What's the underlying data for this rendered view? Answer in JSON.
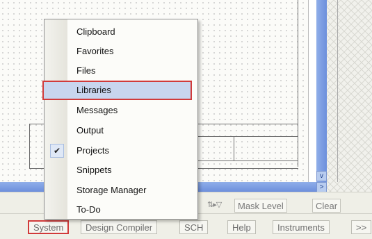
{
  "menu": {
    "items": [
      {
        "label": "Clipboard"
      },
      {
        "label": "Favorites"
      },
      {
        "label": "Files"
      },
      {
        "label": "Libraries"
      },
      {
        "label": "Messages"
      },
      {
        "label": "Output"
      },
      {
        "label": "Projects"
      },
      {
        "label": "Snippets"
      },
      {
        "label": "Storage Manager"
      },
      {
        "label": "To-Do"
      }
    ],
    "selected": "Libraries",
    "checked": "Projects"
  },
  "mask_toolbar": {
    "mask_level_label": "Mask Level",
    "clear_label": "Clear"
  },
  "panel_tabs": [
    "System",
    "Design Compiler",
    "SCH",
    "Help",
    "Instruments",
    ">>"
  ],
  "scroll": {
    "right_arrow": ">",
    "down_arrow": "v"
  },
  "colors": {
    "highlight_border": "#d13a3a",
    "selection_fill": "#c8d5ee",
    "scrollbar": "#7d9de3"
  }
}
